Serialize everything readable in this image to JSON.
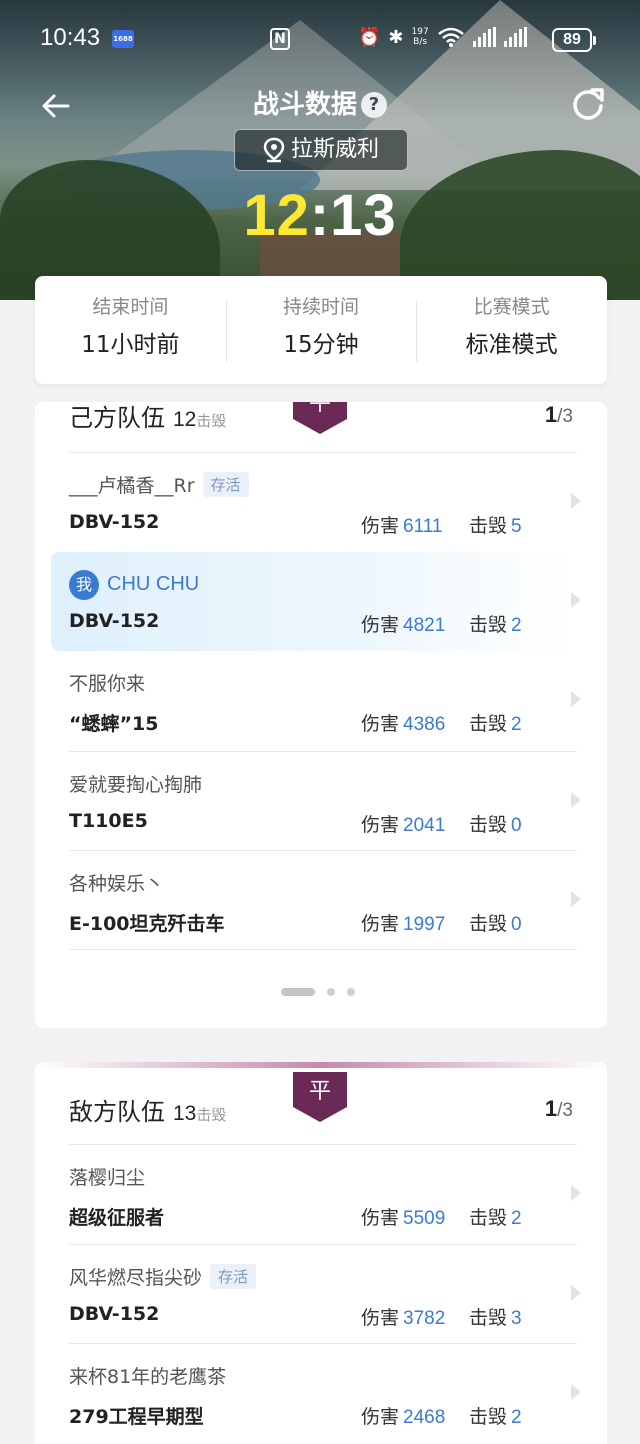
{
  "status_bar": {
    "time": "10:43",
    "app_tag": "1688",
    "net_speed": "197",
    "net_unit": "B/s",
    "battery": "89"
  },
  "header": {
    "title": "战斗数据",
    "help_icon": "?",
    "map_name": "拉斯威利",
    "score_mine": "12",
    "score_sep": ":",
    "score_enemy": "13"
  },
  "info": {
    "end_label": "结束时间",
    "end_value": "11小时前",
    "duration_label": "持续时间",
    "duration_value": "15分钟",
    "mode_label": "比赛模式",
    "mode_value": "标准模式"
  },
  "team1": {
    "badge": "平",
    "title": "己方队伍",
    "kills": "12",
    "kills_label": "击毁",
    "page": "1",
    "total": "/3",
    "players": [
      {
        "name": "___卢橘香__Rr",
        "alive": "存活",
        "tank": "DBV-152",
        "dmg_label": "伤害",
        "damage": "6111",
        "kill_label": "击毁",
        "kills": "5"
      },
      {
        "name": "CHU CHU",
        "me_label": "我",
        "tank": "DBV-152",
        "dmg_label": "伤害",
        "damage": "4821",
        "kill_label": "击毁",
        "kills": "2"
      },
      {
        "name": "不服你来",
        "tank": "“蟋蟀”15",
        "dmg_label": "伤害",
        "damage": "4386",
        "kill_label": "击毁",
        "kills": "2"
      },
      {
        "name": "爱就要掏心掏肺",
        "tank": "T110E5",
        "dmg_label": "伤害",
        "damage": "2041",
        "kill_label": "击毁",
        "kills": "0"
      },
      {
        "name": "各种娱乐丶",
        "tank": "E-100坦克歼击车",
        "dmg_label": "伤害",
        "damage": "1997",
        "kill_label": "击毁",
        "kills": "0"
      }
    ]
  },
  "team2": {
    "badge": "平",
    "title": "敌方队伍",
    "kills": "13",
    "kills_label": "击毁",
    "page": "1",
    "total": "/3",
    "players": [
      {
        "name": "落樱归尘",
        "tank": "超级征服者",
        "dmg_label": "伤害",
        "damage": "5509",
        "kill_label": "击毁",
        "kills": "2"
      },
      {
        "name": "风华燃尽指尖砂",
        "alive": "存活",
        "tank": "DBV-152",
        "dmg_label": "伤害",
        "damage": "3782",
        "kill_label": "击毁",
        "kills": "3"
      },
      {
        "name": "来杯81年的老鹰茶",
        "tank": "279工程早期型",
        "dmg_label": "伤害",
        "damage": "2468",
        "kill_label": "击毁",
        "kills": "2"
      }
    ]
  },
  "colors": {
    "accent": "#3a7ad3",
    "score_mine": "#ffe831",
    "badge": "#6b2a56"
  }
}
